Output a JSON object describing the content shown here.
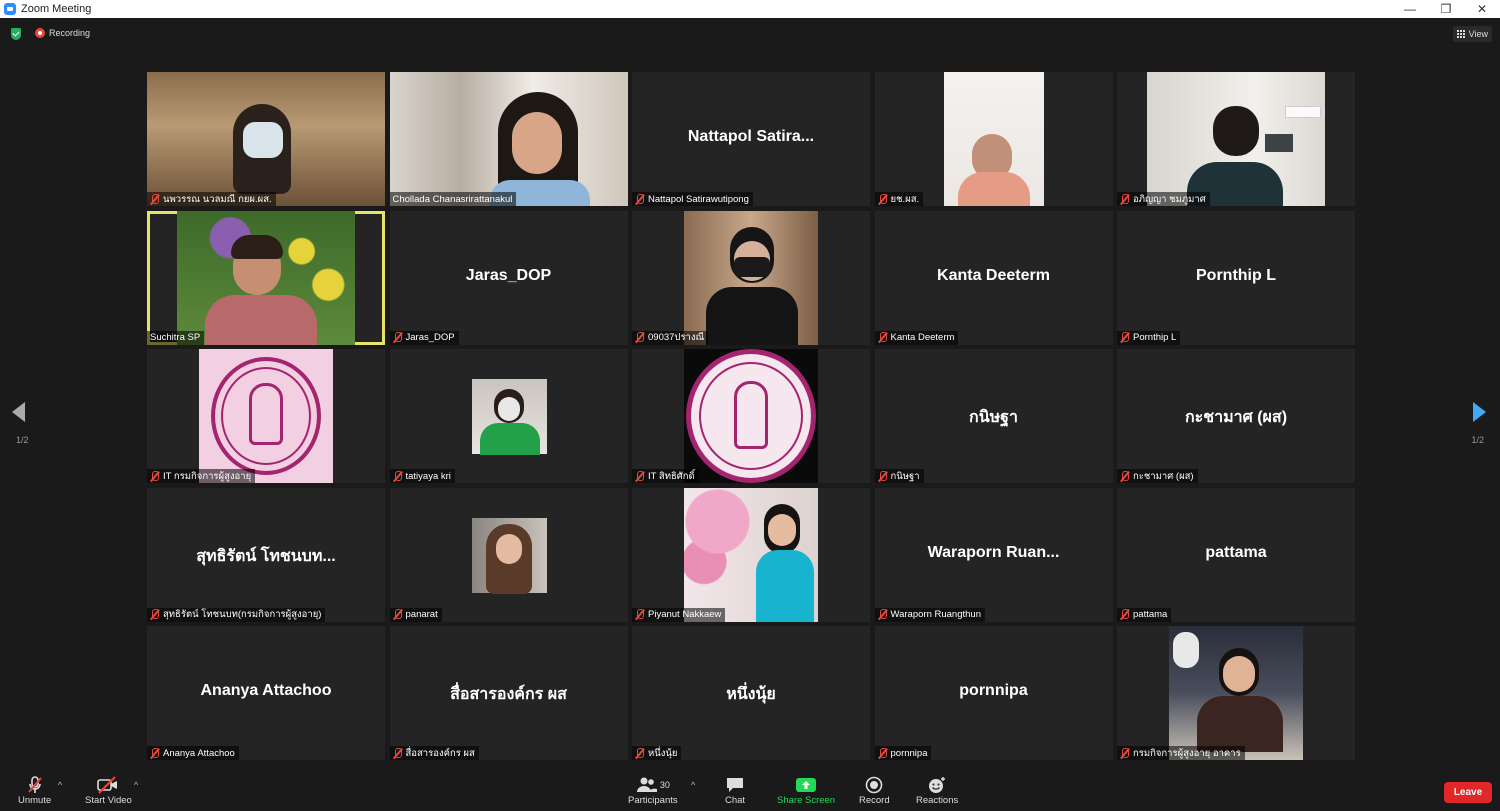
{
  "window": {
    "title": "Zoom Meeting",
    "minimize": "—",
    "restore": "❐",
    "close": "✕"
  },
  "topbar": {
    "recording": "Recording",
    "view": "View"
  },
  "grid": {
    "tiles": [
      {
        "label": "นพวรรณ นวลมณี กยผ.ผส.",
        "big": ""
      },
      {
        "label": "Chollada Chanasrirattanakul",
        "big": ""
      },
      {
        "label": "Nattapol Satirawutipong",
        "big": "Nattapol  Satira..."
      },
      {
        "label": "ยช.ผส.",
        "big": ""
      },
      {
        "label": "อภิญญา ชมภูมาศ",
        "big": ""
      },
      {
        "label": "Suchitra SP",
        "big": ""
      },
      {
        "label": "Jaras_DOP",
        "big": "Jaras_DOP"
      },
      {
        "label": "09037ปรางณี",
        "big": ""
      },
      {
        "label": "Kanta Deeterm",
        "big": "Kanta Deeterm"
      },
      {
        "label": "Pornthip L",
        "big": "Pornthip L"
      },
      {
        "label": "IT กรมกิจการผู้สูงอายุ",
        "big": ""
      },
      {
        "label": "tatiyaya kri",
        "big": ""
      },
      {
        "label": "IT สิทธิศักดิ์",
        "big": ""
      },
      {
        "label": "กนิษฐา",
        "big": "กนิษฐา"
      },
      {
        "label": "กะชามาศ (ผส)",
        "big": "กะชามาศ (ผส)"
      },
      {
        "label": "สุทธิรัตน์ โทชนบท(กรมกิจการผู้สูงอายุ)",
        "big": "สุทธิรัตน์ โทชนบท..."
      },
      {
        "label": "panarat",
        "big": ""
      },
      {
        "label": "Piyanut Nakkaew",
        "big": ""
      },
      {
        "label": "Waraporn Ruangthun",
        "big": "Waraporn  Ruan..."
      },
      {
        "label": "pattama",
        "big": "pattama"
      },
      {
        "label": "Ananya Attachoo",
        "big": "Ananya Attachoo"
      },
      {
        "label": "สื่อสารองค์กร ผส",
        "big": "สื่อสารองค์กร ผส"
      },
      {
        "label": "หนึ่งนุ้ย",
        "big": "หนึ่งนุ้ย"
      },
      {
        "label": "pornnipa",
        "big": "pornnipa"
      },
      {
        "label": "กรมกิจการผู้สูงอายุ อาคาร",
        "big": ""
      }
    ]
  },
  "pager": {
    "left": "1/2",
    "right": "1/2"
  },
  "toolbar": {
    "unmute": "Unmute",
    "start_video": "Start Video",
    "participants": "Participants",
    "participants_count": "30",
    "chat": "Chat",
    "share_screen": "Share Screen",
    "record": "Record",
    "reactions": "Reactions",
    "leave": "Leave"
  },
  "colors": {
    "accent": "#2d8cff",
    "share": "#23d959",
    "leave": "#e02828",
    "active_speaker": "#e6e46a"
  }
}
